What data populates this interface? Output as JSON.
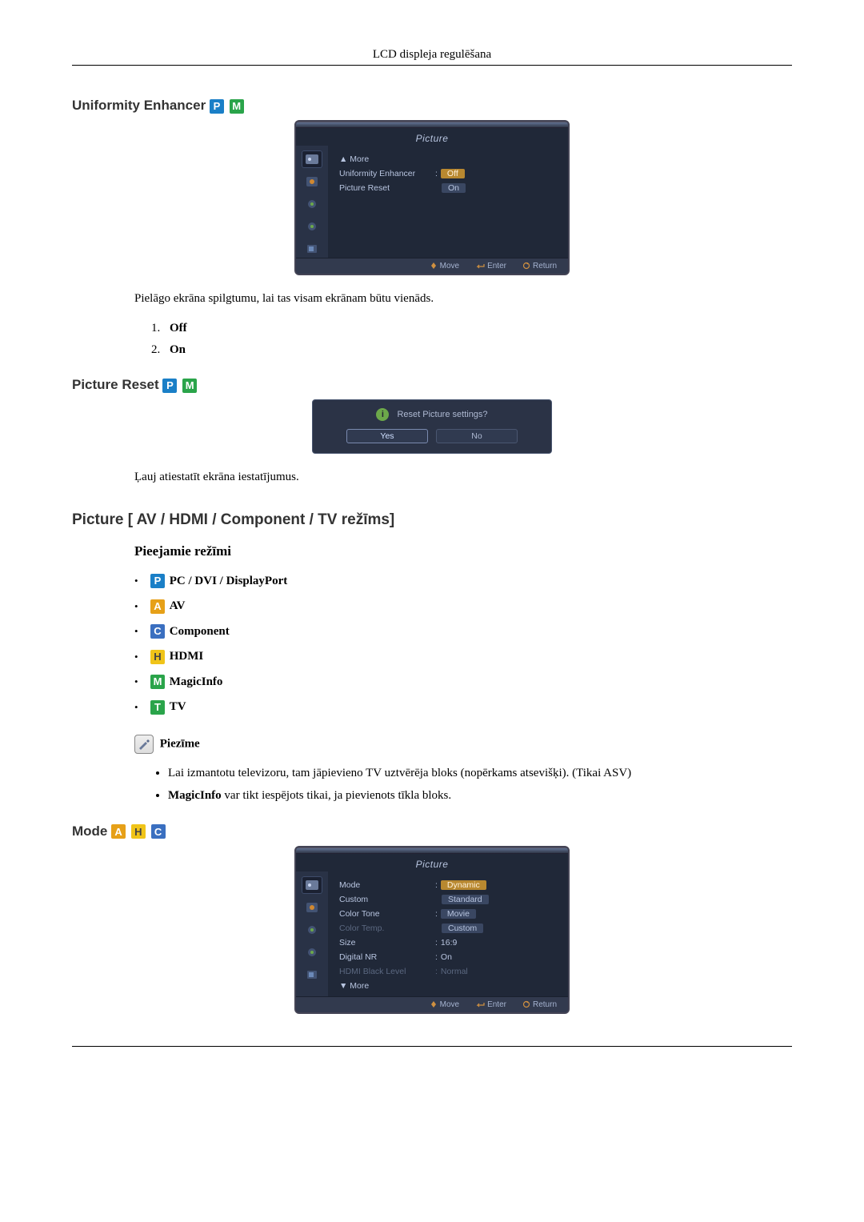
{
  "header": "LCD displeja regulēšana",
  "section1": {
    "title": "Uniformity Enhancer",
    "desc": "Pielāgo ekrāna spilgtumu, lai tas visam ekrānam būtu vienāds.",
    "opt1": "Off",
    "opt2": "On"
  },
  "osd1": {
    "title": "Picture",
    "more": "▲ More",
    "row1": "Uniformity Enhancer",
    "row2": "Picture Reset",
    "val_off": "Off",
    "val_on": "On",
    "foot_move": "Move",
    "foot_enter": "Enter",
    "foot_return": "Return"
  },
  "section2": {
    "title": "Picture Reset",
    "desc": "Ļauj atiestatīt ekrāna iestatījumus."
  },
  "dialog": {
    "question": "Reset Picture settings?",
    "yes": "Yes",
    "no": "No"
  },
  "section3": {
    "title": "Picture [ AV / HDMI / Component / TV režīms]"
  },
  "modes": {
    "heading": "Pieejamie režīmi",
    "p": "PC / DVI / DisplayPort",
    "a": "AV",
    "c": "Component",
    "h": "HDMI",
    "m": "MagicInfo",
    "t": "TV"
  },
  "note": {
    "label": "Piezīme",
    "b1": "Lai izmantotu televizoru, tam jāpievieno TV uztvērēja bloks (nopērkams atsevišķi). (Tikai ASV)",
    "b2a": "MagicInfo",
    "b2b": " var tikt iespējots tikai, ja pievienots tīkla bloks."
  },
  "section4": {
    "title": "Mode"
  },
  "osd2": {
    "title": "Picture",
    "r_mode": "Mode",
    "r_custom": "Custom",
    "r_colortone": "Color Tone",
    "r_colortemp": "Color Temp.",
    "r_size": "Size",
    "r_dnr": "Digital NR",
    "r_hdmi": "HDMI Black Level",
    "v_dynamic": "Dynamic",
    "v_standard": "Standard",
    "v_movie": "Movie",
    "v_custom": "Custom",
    "v_size": "16:9",
    "v_on": "On",
    "v_normal": "Normal",
    "more": "▼ More",
    "foot_move": "Move",
    "foot_enter": "Enter",
    "foot_return": "Return"
  }
}
